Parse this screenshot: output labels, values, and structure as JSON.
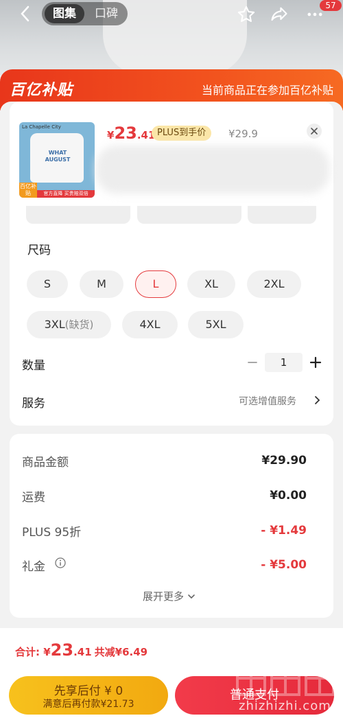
{
  "top_bar": {
    "tab_gallery": "图集",
    "tab_reputation": "口碑",
    "notification_count": "57"
  },
  "banner": {
    "logo": "百亿补贴",
    "note": "当前商品正在参加百亿补贴"
  },
  "product": {
    "thumb_brand": "La Chapelle City",
    "thumb_text": "WHAT AUGUST",
    "thumb_tag1": "百亿补贴",
    "thumb_tag2": "官方直降 买贵赔双倍",
    "price_yen": "¥",
    "price_int": "23",
    "price_dec": ".41",
    "plus_tag": "PLUS到手价",
    "original_price": "¥29.9"
  },
  "size": {
    "title": "尺码",
    "options": [
      "S",
      "M",
      "L",
      "XL",
      "2XL",
      "3XL",
      "4XL",
      "5XL"
    ],
    "oos_suffix": "(缺货)",
    "selected": "L"
  },
  "quantity": {
    "label": "数量",
    "value": "1"
  },
  "service": {
    "label": "服务",
    "link": "可选增值服务"
  },
  "fees": {
    "goods_label": "商品金额",
    "goods_value": "¥29.90",
    "shipping_label": "运费",
    "shipping_value": "¥0.00",
    "plus_label": "PLUS 95折",
    "plus_value": "- ¥1.49",
    "gift_label": "礼金",
    "gift_value": "- ¥5.00",
    "expand": "展开更多"
  },
  "bottom": {
    "total_label": "合计: ",
    "total_yen": "¥",
    "total_int": "23",
    "total_dec": ".41",
    "total_save": "共减¥6.49",
    "pay_later_line1": "先享后付 ¥ 0",
    "pay_later_line2": "满意后再付款¥21.73",
    "pay_normal": "普通支付",
    "watermark": "zhizhizhi.com"
  },
  "colors": {
    "accent_red": "#e4393c",
    "banner_orange": "#f2521e",
    "pay_later_yellow": "#f7c11d"
  }
}
